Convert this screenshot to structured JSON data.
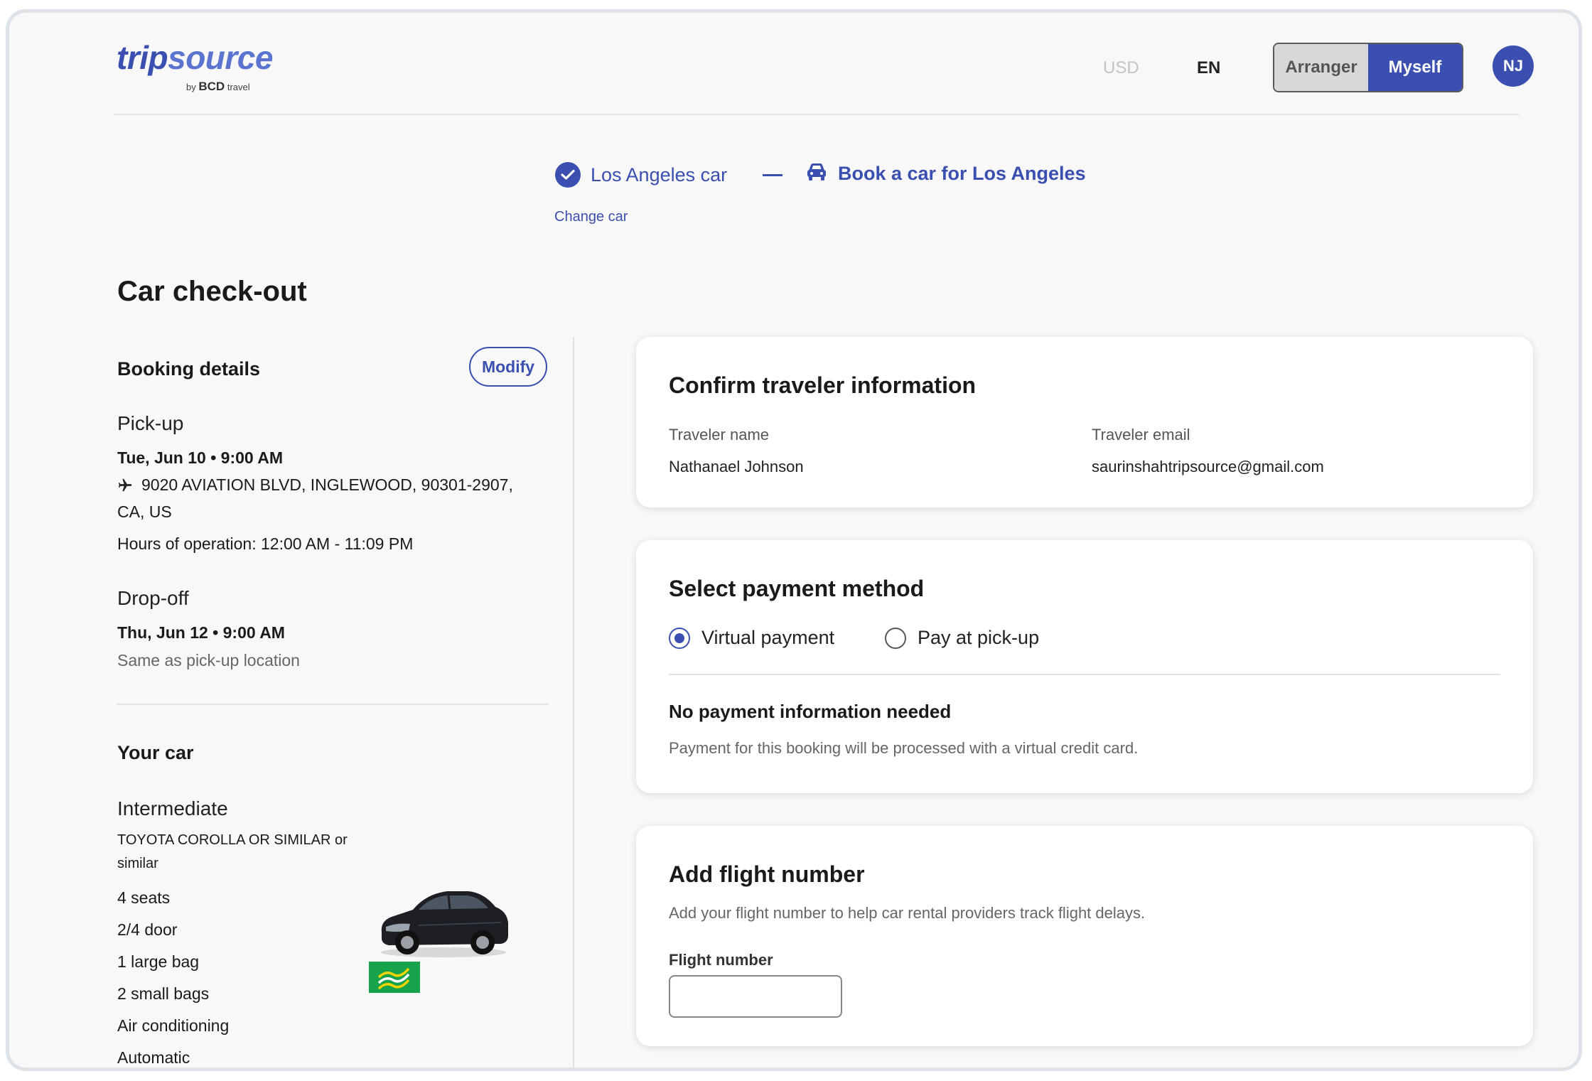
{
  "header": {
    "logo_main_a": "trip",
    "logo_main_b": "source",
    "logo_sub_by": "by",
    "logo_sub_brand": "BCD",
    "logo_sub_travel": "travel",
    "currency": "USD",
    "language": "EN",
    "toggle_arranger": "Arranger",
    "toggle_myself": "Myself",
    "avatar_initials": "NJ"
  },
  "progress": {
    "step1_label": "Los Angeles car",
    "step2_label": "Book a car for Los Angeles",
    "change_car": "Change car"
  },
  "page_title": "Car check-out",
  "booking": {
    "title": "Booking details",
    "modify": "Modify",
    "pickup_label": "Pick-up",
    "pickup_date": "Tue, Jun 10 • 9:00 AM",
    "pickup_address_line1": "9020 AVIATION BLVD, INGLEWOOD, 90301-2907,",
    "pickup_address_line2": "CA, US",
    "hours": "Hours of operation: 12:00 AM - 11:09 PM",
    "dropoff_label": "Drop-off",
    "dropoff_date": "Thu, Jun 12 • 9:00 AM",
    "dropoff_location": "Same as pick-up location"
  },
  "car": {
    "title": "Your car",
    "class": "Intermediate",
    "model_line1": "TOYOTA COROLLA OR SIMILAR or",
    "model_line2": "similar",
    "features": [
      "4 seats",
      "2/4 door",
      "1 large bag",
      "2 small bags",
      "Air conditioning",
      "Automatic"
    ]
  },
  "traveler": {
    "title": "Confirm traveler information",
    "name_label": "Traveler name",
    "name_value": "Nathanael Johnson",
    "email_label": "Traveler email",
    "email_value": "saurinshahtripsource@gmail.com"
  },
  "payment": {
    "title": "Select payment method",
    "option_virtual": "Virtual payment",
    "option_pickup": "Pay at pick-up",
    "selected": "Virtual payment",
    "info_title": "No payment information needed",
    "info_text": "Payment for this booking will be processed with a virtual credit card."
  },
  "flight": {
    "title": "Add flight number",
    "subtitle": "Add your flight number to help car rental providers track flight delays.",
    "field_label": "Flight number",
    "field_value": ""
  },
  "colors": {
    "accent": "#3a4fb0",
    "background": "#f8f8f8",
    "brand_green": "#17a34a"
  }
}
